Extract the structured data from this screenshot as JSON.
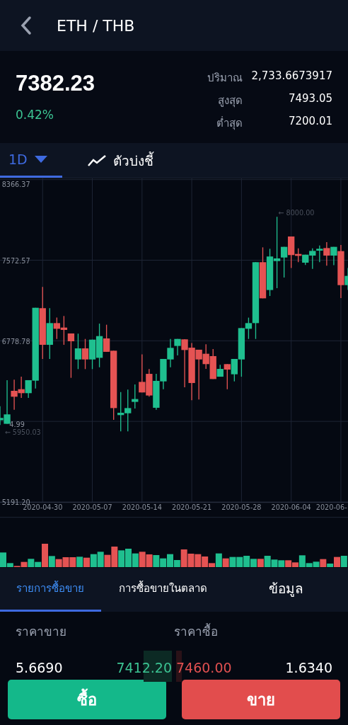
{
  "header": {
    "title": "ETH / THB"
  },
  "ticker": {
    "price": "7382.23",
    "change": "0.42%",
    "stats": [
      {
        "label": "ปริมาณ",
        "value": "2,733.6673917"
      },
      {
        "label": "สูงสุด",
        "value": "7493.05"
      },
      {
        "label": "ต่ำสุด",
        "value": "7200.01"
      }
    ]
  },
  "chart_toolbar": {
    "interval": "1D",
    "indicators": "ตัวบ่งชี้"
  },
  "chart": {
    "chart_data": {
      "type": "candlestick",
      "x": [
        "2020-04-24",
        "2020-04-25",
        "2020-04-26",
        "2020-04-27",
        "2020-04-28",
        "2020-04-29",
        "2020-04-30",
        "2020-05-01",
        "2020-05-02",
        "2020-05-03",
        "2020-05-04",
        "2020-05-05",
        "2020-05-06",
        "2020-05-07",
        "2020-05-08",
        "2020-05-09",
        "2020-05-10",
        "2020-05-11",
        "2020-05-12",
        "2020-05-13",
        "2020-05-14",
        "2020-05-15",
        "2020-05-16",
        "2020-05-17",
        "2020-05-18",
        "2020-05-19",
        "2020-05-20",
        "2020-05-21",
        "2020-05-22",
        "2020-05-23",
        "2020-05-24",
        "2020-05-25",
        "2020-05-26",
        "2020-05-27",
        "2020-05-28",
        "2020-05-29",
        "2020-05-30",
        "2020-05-31",
        "2020-06-01",
        "2020-06-02",
        "2020-06-03",
        "2020-06-04",
        "2020-06-05",
        "2020-06-06",
        "2020-06-07",
        "2020-06-08",
        "2020-06-09",
        "2020-06-10",
        "2020-06-11",
        "2020-06-12"
      ],
      "ohlc": [
        [
          5996,
          6135,
          5950.03,
          6019
        ],
        [
          5961,
          6391,
          5961,
          6054
        ],
        [
          6286,
          6395,
          6100,
          6228
        ],
        [
          6302,
          6425,
          6216,
          6263
        ],
        [
          6263,
          6391,
          6216,
          6391
        ],
        [
          6386,
          7104,
          6309,
          7104
        ],
        [
          7100,
          7309,
          6600,
          6739
        ],
        [
          6739,
          7100,
          6600,
          6953
        ],
        [
          6953,
          7007,
          6797,
          6897
        ],
        [
          6909,
          7023,
          6739,
          6886
        ],
        [
          6851,
          6851,
          6414,
          6774
        ],
        [
          6595,
          6849,
          6500,
          6704
        ],
        [
          6704,
          6797,
          6500,
          6595
        ],
        [
          6595,
          6790,
          6500,
          6790
        ],
        [
          6611,
          6948,
          6518,
          6825
        ],
        [
          6802,
          6937,
          6670,
          6670
        ],
        [
          6681,
          6681,
          6000,
          6116
        ],
        [
          6047,
          6274,
          5886,
          6070
        ],
        [
          6065,
          6298,
          5886,
          6116
        ],
        [
          6177,
          6349,
          6112,
          6205
        ],
        [
          6374,
          6646,
          6270,
          6270
        ],
        [
          6453,
          6500,
          6228,
          6240
        ],
        [
          6119,
          6453,
          6100,
          6384
        ],
        [
          6379,
          6600,
          6302,
          6600
        ],
        [
          6595,
          6797,
          6518,
          6709
        ],
        [
          6728,
          6797,
          6635,
          6797
        ],
        [
          6793,
          6793,
          6321,
          6688
        ],
        [
          6711,
          6756,
          6193,
          6363
        ],
        [
          6691,
          6691,
          6200,
          6595
        ],
        [
          6651,
          6744,
          6502,
          6549
        ],
        [
          6628,
          6697,
          6402,
          6402
        ],
        [
          6425,
          6542,
          6425,
          6502
        ],
        [
          6549,
          6549,
          6302,
          6495
        ],
        [
          6449,
          6600,
          6379,
          6600
        ],
        [
          6595,
          6904,
          6425,
          6904
        ],
        [
          6897,
          7007,
          6797,
          6953
        ],
        [
          6953,
          7553,
          6797,
          7553
        ],
        [
          7553,
          7699,
          7197,
          7197
        ],
        [
          7279,
          7685,
          7220,
          7609
        ],
        [
          7564,
          8000,
          7297,
          7590
        ],
        [
          7599,
          7704,
          7402,
          7704
        ],
        [
          7806,
          7806,
          7495,
          7623
        ],
        [
          7634,
          7690,
          7553,
          7616
        ],
        [
          7548,
          7627,
          7525,
          7627
        ],
        [
          7618,
          7690,
          7488,
          7664
        ],
        [
          7669,
          7718,
          7553,
          7685
        ],
        [
          7692,
          7750,
          7518,
          7618
        ],
        [
          7618,
          7704,
          7523,
          7704
        ],
        [
          7662,
          7722,
          7200,
          7327
        ],
        [
          7327,
          7495,
          7279,
          7418
        ]
      ],
      "xlim": [
        "2020-04-24",
        "2020-06-12"
      ],
      "grid": true,
      "ylim": [
        5191.2,
        8366.37
      ],
      "yticks": [
        {
          "value": 8366.37,
          "label": "8366.37"
        },
        {
          "value": 7572.57,
          "label": "7572.57"
        },
        {
          "value": 6778.78,
          "label": "6778.78"
        },
        {
          "value": 5191.2,
          "label": "5191.20"
        }
      ],
      "xticks": [
        {
          "value": "2020-04-30",
          "label": "2020-04-30"
        },
        {
          "value": "2020-05-07",
          "label": "2020-05-07"
        },
        {
          "value": "2020-05-14",
          "label": "2020-05-14"
        },
        {
          "value": "2020-05-21",
          "label": "2020-05-21"
        },
        {
          "value": "2020-05-28",
          "label": "2020-05-28"
        },
        {
          "value": "2020-06-04",
          "label": "2020-06-04"
        }
      ],
      "annotations": [
        "← 8000.00",
        "← 5950.03"
      ]
    },
    "partial_y_label": "4.99",
    "cut_x_label": "2020-06-"
  },
  "tabs": [
    {
      "label": "รายการซื้อขาย",
      "selected": true
    },
    {
      "label": "การซื้อขายในตลาด",
      "selected": false
    },
    {
      "label": "ข้อมูล",
      "selected": false
    }
  ],
  "order_book": {
    "headers": [
      "ราคาขาย",
      "ราคาซื้อ"
    ],
    "row": {
      "bid_amount": "5.6690",
      "bid_price": "7412.20",
      "ask_price": "7460.00",
      "ask_amount": "1.6340"
    }
  },
  "buttons": [
    {
      "label": "ซื้อ",
      "kind": "buy"
    },
    {
      "label": "ขาย",
      "kind": "sell"
    }
  ]
}
